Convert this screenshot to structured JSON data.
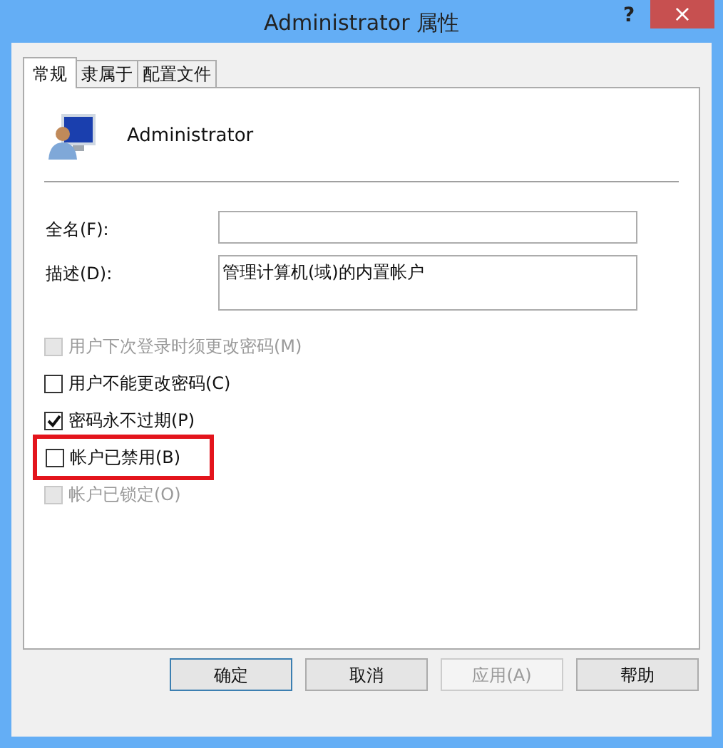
{
  "window": {
    "title": "Administrator 属性",
    "help": "?",
    "close": "×"
  },
  "tabs": [
    {
      "label": "常规",
      "selected": true
    },
    {
      "label": "隶属于",
      "selected": false
    },
    {
      "label": "配置文件",
      "selected": false
    }
  ],
  "user": {
    "name": "Administrator"
  },
  "fields": [
    {
      "label": "全名(F):",
      "kind": "line"
    },
    {
      "label": "描述(D):",
      "value": "管理计算机(域)的内置帐户",
      "kind": "box"
    }
  ],
  "options": [
    {
      "label": "用户下次登录时须更改密码(M)",
      "checked": false,
      "disabled": true,
      "highlighted": false
    },
    {
      "label": "用户不能更改密码(C)",
      "checked": false,
      "disabled": false,
      "highlighted": false
    },
    {
      "label": "密码永不过期(P)",
      "checked": true,
      "disabled": false,
      "highlighted": false
    },
    {
      "label": "帐户已禁用(B)",
      "checked": false,
      "disabled": false,
      "highlighted": true
    },
    {
      "label": "帐户已锁定(O)",
      "checked": false,
      "disabled": true,
      "highlighted": false
    }
  ],
  "buttons": [
    {
      "label": "确定",
      "default": true,
      "disabled": false
    },
    {
      "label": "取消",
      "default": false,
      "disabled": false
    },
    {
      "label": "应用(A)",
      "default": false,
      "disabled": true
    },
    {
      "label": "帮助",
      "default": false,
      "disabled": false
    }
  ]
}
